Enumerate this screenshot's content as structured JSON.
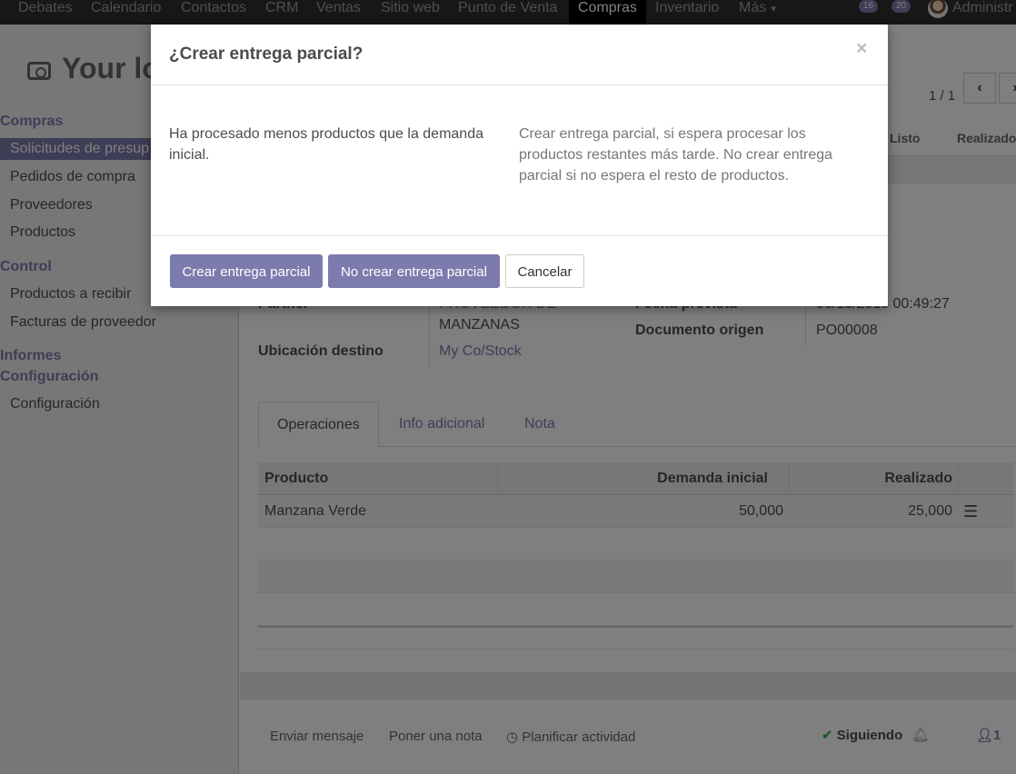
{
  "navbar": {
    "items": [
      "Debates",
      "Calendario",
      "Contactos",
      "CRM",
      "Ventas",
      "Sitio web",
      "Punto de Venta",
      "Compras",
      "Inventario",
      "Más"
    ],
    "active": "Compras",
    "more_icon": "caret-down-icon",
    "activities_count": "16",
    "messages_count": "20",
    "user": "Administr"
  },
  "sidebar": {
    "logo_text": "Your lo",
    "sections": [
      {
        "title": "Compras",
        "items": [
          "Solicitudes de presup",
          "Pedidos de compra",
          "Proveedores",
          "Productos"
        ]
      },
      {
        "title": "Control",
        "items": [
          "Productos a recibir",
          "Facturas de proveedor"
        ]
      },
      {
        "title": "Informes",
        "items": []
      },
      {
        "title": "Configuración",
        "items": [
          "Configuración"
        ]
      }
    ]
  },
  "main": {
    "pager": "1 / 1",
    "status_steps": [
      "Listo",
      "Realizado"
    ],
    "fields": {
      "partner_label": "Partner",
      "partner_value_line1": "PROVEEDOR DE",
      "partner_value_line2": "MANZANAS",
      "location_label": "Ubicación destino",
      "location_value": "My Co/Stock",
      "scheduled_label": "Fecha prevista",
      "scheduled_value": "06/13/2018 00:49:27",
      "origin_label": "Documento origen",
      "origin_value": "PO00008"
    },
    "tabs": [
      "Operaciones",
      "Info adicional",
      "Nota"
    ],
    "table": {
      "headers": [
        "Producto",
        "Demanda inicial",
        "Realizado"
      ],
      "rows": [
        {
          "product": "Manzana Verde",
          "demand": "50,000",
          "done": "25,000"
        }
      ]
    },
    "chatter": {
      "send_message": "Enviar mensaje",
      "log_note": "Poner una nota",
      "schedule": "Planificar actividad",
      "following": "Siguiendo",
      "followers": "1"
    }
  },
  "modal": {
    "title": "¿Crear entrega parcial?",
    "close": "×",
    "left_text": "Ha procesado menos productos que la demanda inicial.",
    "right_text": "Crear entrega parcial, si espera procesar los productos restantes más tarde. No crear entrega parcial si no espera el resto de productos.",
    "buttons": {
      "create": "Crear entrega parcial",
      "no_create": "No crear entrega parcial",
      "cancel": "Cancelar"
    }
  },
  "colors": {
    "accent": "#7c7bad",
    "navbar": "#2f2f2f"
  }
}
